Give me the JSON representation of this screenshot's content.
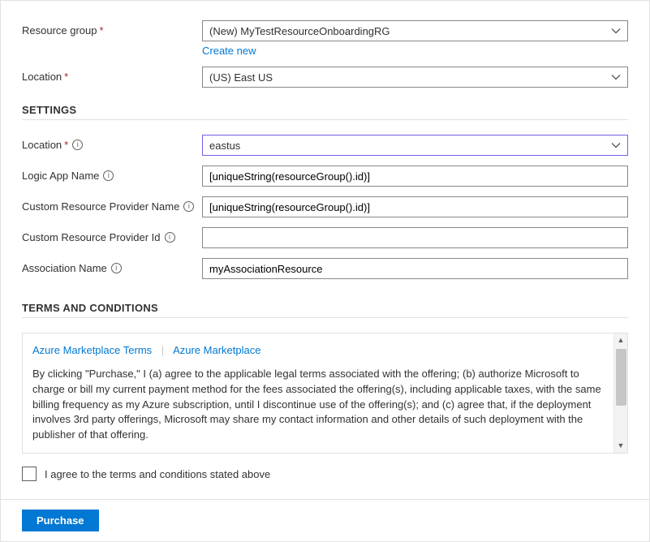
{
  "basics": {
    "resource_group_label": "Resource group",
    "resource_group_value": "(New) MyTestResourceOnboardingRG",
    "create_new_link": "Create new",
    "location_label": "Location",
    "location_value": "(US) East US"
  },
  "settings": {
    "heading": "SETTINGS",
    "location_label": "Location",
    "location_value": "eastus",
    "logic_app_label": "Logic App Name",
    "logic_app_value": "[uniqueString(resourceGroup().id)]",
    "crp_name_label": "Custom Resource Provider Name",
    "crp_name_value": "[uniqueString(resourceGroup().id)]",
    "crp_id_label": "Custom Resource Provider Id",
    "crp_id_value": "",
    "assoc_label": "Association Name",
    "assoc_value": "myAssociationResource"
  },
  "terms": {
    "heading": "TERMS AND CONDITIONS",
    "tab1": "Azure Marketplace Terms",
    "tab2": "Azure Marketplace",
    "body": "By clicking \"Purchase,\" I (a) agree to the applicable legal terms associated with the offering; (b) authorize Microsoft to charge or bill my current payment method for the fees associated the offering(s), including applicable taxes, with the same billing frequency as my Azure subscription, until I discontinue use of the offering(s); and (c) agree that, if the deployment involves 3rd party offerings, Microsoft may share my contact information and other details of such deployment with the publisher of that offering.",
    "agree_label": "I agree to the terms and conditions stated above"
  },
  "footer": {
    "purchase_label": "Purchase"
  }
}
